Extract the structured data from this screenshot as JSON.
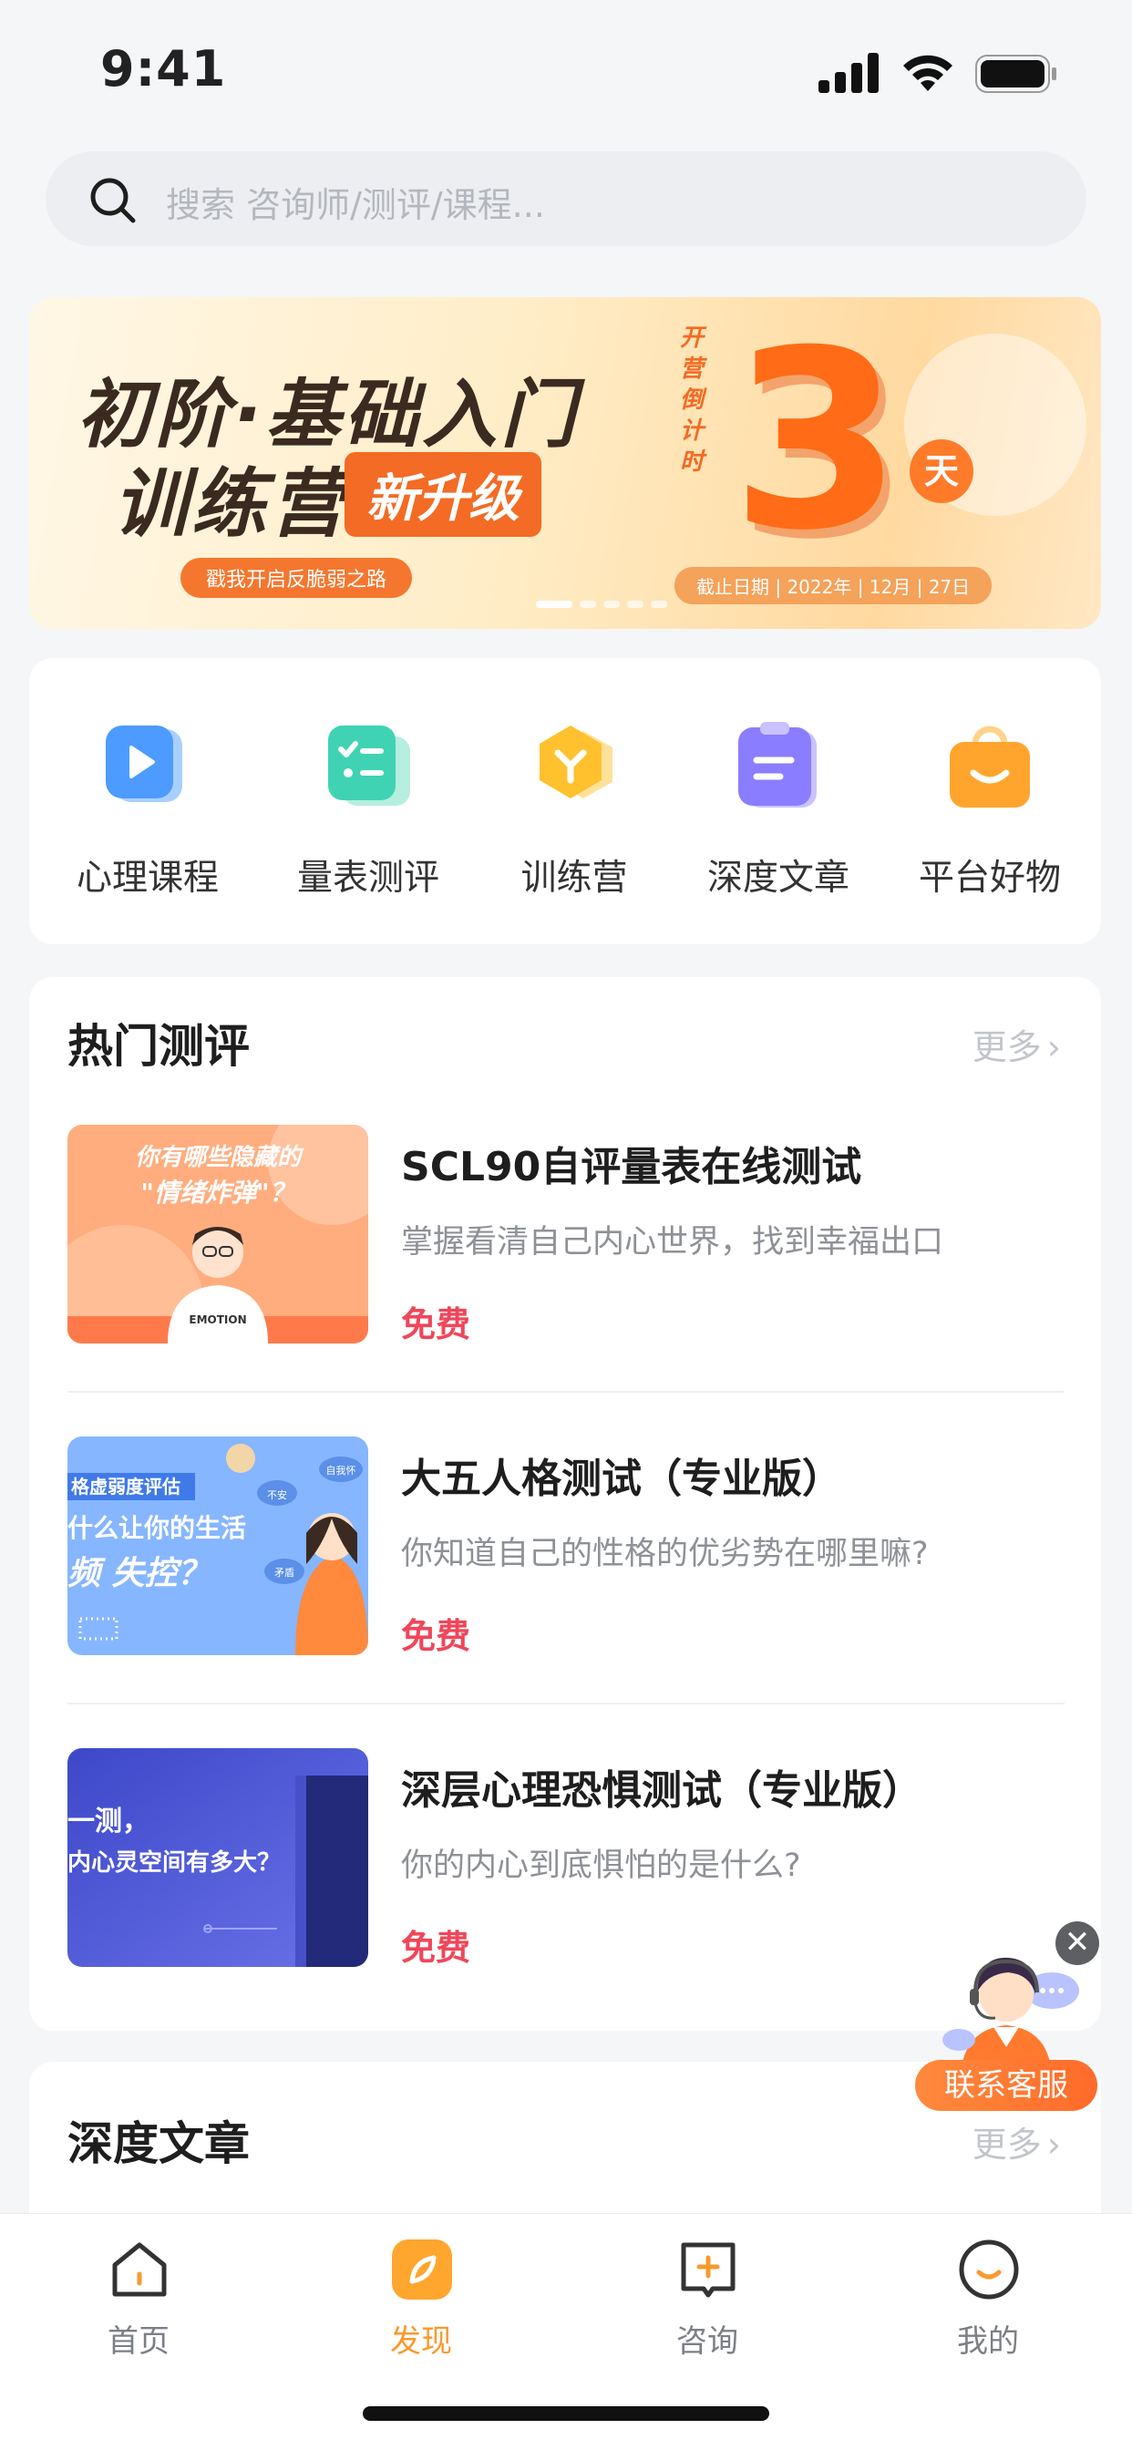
{
  "status": {
    "time": "9:41"
  },
  "search": {
    "placeholder": "搜索 咨询师/测评/课程..."
  },
  "banner": {
    "line1": "初阶·基础入门",
    "line2": "训练营",
    "badge": "新升级",
    "slogan": "戳我开启反脆弱之路",
    "countdown_label": "开营倒计时",
    "countdown_value": "3",
    "countdown_unit": "天",
    "deadline": "截止日期 | 2022年 | 12月 | 27日",
    "slides": 5,
    "active_slide": 1
  },
  "quick_nav": [
    {
      "label": "心理课程",
      "icon": "play-video-icon",
      "color": "#4d9bff"
    },
    {
      "label": "量表测评",
      "icon": "checklist-icon",
      "color": "#3fd3b3"
    },
    {
      "label": "训练营",
      "icon": "hexagon-y-icon",
      "color": "#ffc12e"
    },
    {
      "label": "深度文章",
      "icon": "clipboard-icon",
      "color": "#8b7dff"
    },
    {
      "label": "平台好物",
      "icon": "shopping-bag-icon",
      "color": "#ffa52e"
    }
  ],
  "hot_tests": {
    "title": "热门测评",
    "more": "更多",
    "items": [
      {
        "title": "SCL90自评量表在线测试",
        "desc": "掌握看清自己内心世界，找到幸福出口",
        "price": "免费",
        "thumb_text1": "你有哪些隐藏的",
        "thumb_text2": "\"情绪炸弹\"？",
        "thumb_tag": "EMOTION"
      },
      {
        "title": "大五人格测试（专业版）",
        "desc": "你知道自己的性格的优劣势在哪里嘛?",
        "price": "免费",
        "thumb_text1": "格虚弱度评估",
        "thumb_text2": "什么让你的生活",
        "thumb_text3": "频 失控？",
        "thumb_bubble1": "不安",
        "thumb_bubble2": "自我怀",
        "thumb_bubble3": "矛盾"
      },
      {
        "title": "深层心理恐惧测试（专业版）",
        "desc": "你的内心到底惧怕的是什么?",
        "price": "免费",
        "thumb_text1": "一测，",
        "thumb_text2": "内心灵空间有多大？"
      }
    ]
  },
  "articles": {
    "title": "深度文章",
    "more": "更多"
  },
  "customer_service": {
    "label": "联系客服",
    "close": "✕"
  },
  "tabbar": [
    {
      "label": "首页",
      "icon": "home-icon",
      "active": false
    },
    {
      "label": "发现",
      "icon": "discover-icon",
      "active": true
    },
    {
      "label": "咨询",
      "icon": "consult-icon",
      "active": false
    },
    {
      "label": "我的",
      "icon": "profile-icon",
      "active": false
    }
  ]
}
